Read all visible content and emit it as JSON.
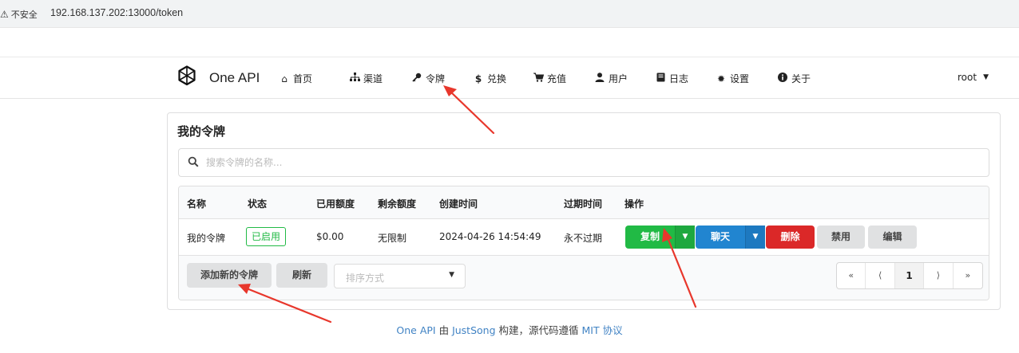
{
  "browser": {
    "insecure_label": "不安全",
    "url": "192.168.137.202:13000/token"
  },
  "header": {
    "brand": "One API",
    "nav": [
      {
        "label": "首页",
        "icon": "home-icon"
      },
      {
        "label": "渠道",
        "icon": "sitemap-icon"
      },
      {
        "label": "令牌",
        "icon": "key-icon"
      },
      {
        "label": "兑换",
        "icon": "dollar-icon"
      },
      {
        "label": "充值",
        "icon": "cart-icon"
      },
      {
        "label": "用户",
        "icon": "user-icon"
      },
      {
        "label": "日志",
        "icon": "book-icon"
      },
      {
        "label": "设置",
        "icon": "cog-icon"
      },
      {
        "label": "关于",
        "icon": "info-icon"
      }
    ],
    "user": "root"
  },
  "card": {
    "title": "我的令牌",
    "search_placeholder": "搜索令牌的名称...",
    "columns": [
      "名称",
      "状态",
      "已用额度",
      "剩余额度",
      "创建时间",
      "过期时间",
      "操作"
    ],
    "rows": [
      {
        "name": "我的令牌",
        "status": "已启用",
        "used": "$0.00",
        "remaining": "无限制",
        "created": "2024-04-26 14:54:49",
        "expires": "永不过期"
      }
    ],
    "actions": {
      "copy": "复制",
      "chat": "聊天",
      "delete": "删除",
      "disable": "禁用",
      "edit": "编辑"
    },
    "footer": {
      "add_button": "添加新的令牌",
      "refresh_button": "刷新",
      "sort_placeholder": "排序方式"
    },
    "pagination": {
      "first": "«",
      "prev": "⟨",
      "current": "1",
      "next": "⟩",
      "last": "»"
    }
  },
  "page_footer": {
    "link1": "One API",
    "text1": " 由 ",
    "link2": "JustSong",
    "text2": " 构建，源代码遵循 ",
    "link3": "MIT 协议"
  },
  "colors": {
    "green": "#21ba45",
    "blue": "#2185d0",
    "red": "#db2828",
    "annotation_arrow": "#e8372c"
  }
}
